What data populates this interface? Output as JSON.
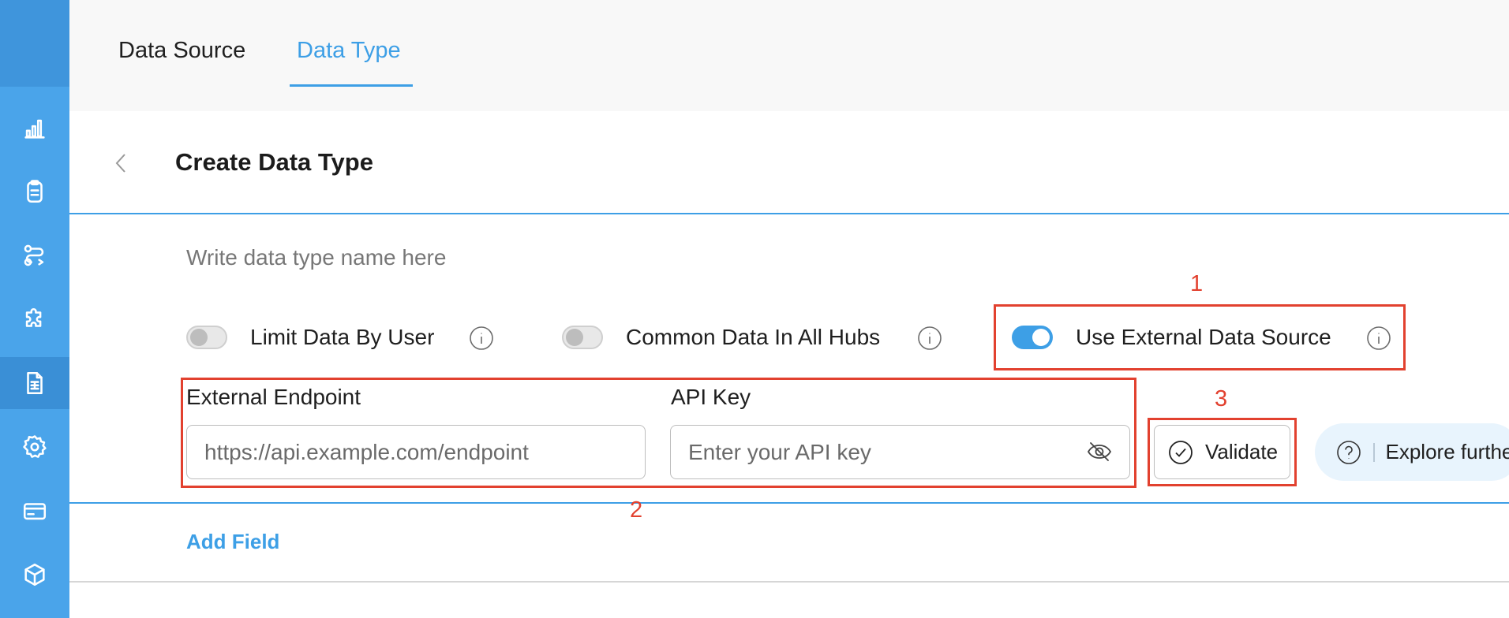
{
  "tabs": [
    {
      "label": "Data Source",
      "active": false
    },
    {
      "label": "Data Type",
      "active": true
    }
  ],
  "sidebar": {
    "items": [
      {
        "icon": "bar-chart-icon"
      },
      {
        "icon": "clipboard-icon"
      },
      {
        "icon": "route-icon"
      },
      {
        "icon": "puzzle-icon"
      },
      {
        "icon": "document-icon",
        "active": true
      },
      {
        "icon": "gear-icon"
      },
      {
        "icon": "credit-card-icon"
      },
      {
        "icon": "cube-icon"
      }
    ]
  },
  "header": {
    "title": "Create Data Type"
  },
  "form": {
    "name_placeholder": "Write data type name here",
    "toggles": [
      {
        "label": "Limit Data By User",
        "on": false
      },
      {
        "label": "Common Data In All Hubs",
        "on": false
      },
      {
        "label": "Use External Data Source",
        "on": true
      }
    ],
    "endpoint": {
      "label": "External Endpoint",
      "value": "",
      "placeholder": "https://api.example.com/endpoint"
    },
    "api_key": {
      "label": "API Key",
      "value": "",
      "placeholder": "Enter your API key"
    },
    "validate_label": "Validate",
    "explore_label": "Explore further",
    "add_field_label": "Add Field"
  },
  "annotations": [
    "1",
    "2",
    "3"
  ],
  "colors": {
    "sidebar": "#4aa4ea",
    "accent": "#3d9fe6",
    "annotation": "#e2412f"
  }
}
